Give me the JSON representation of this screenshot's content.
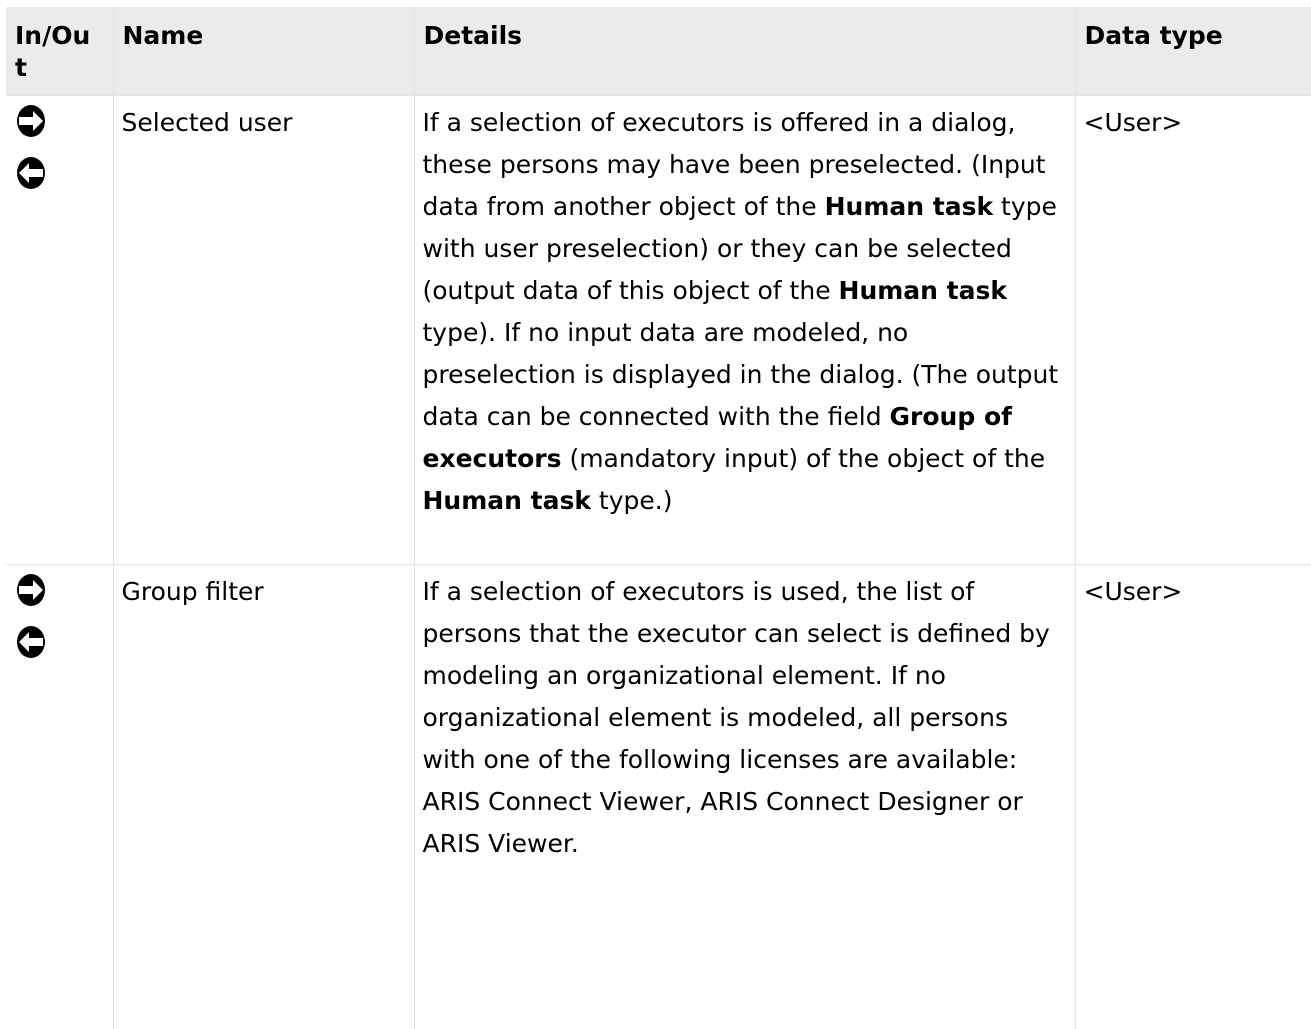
{
  "table": {
    "headers": {
      "inout": "In/Out",
      "name": "Name",
      "details": "Details",
      "datatype": "Data type"
    },
    "rows": [
      {
        "icons": [
          "output-arrow-icon",
          "input-arrow-icon"
        ],
        "name": "Selected user",
        "details": {
          "p1": "If a selection of executors is offered in a dialog, these persons may have been preselected. (Input data from another object of the ",
          "b1": "Human task",
          "p2": " type with user preselection) or they can be selected (output data of this object of the ",
          "b2": "Human task",
          "p3": " type). If no input data are modeled, no preselection is displayed in the dialog. (The output data can be connected with the field ",
          "b3": "Group of executors",
          "p4": " (mandatory input) of the object of the ",
          "b4": "Human task",
          "p5": " type.)"
        },
        "datatype": "<User>"
      },
      {
        "icons": [
          "output-arrow-icon",
          "input-arrow-icon"
        ],
        "name": "Group filter",
        "details": {
          "p1": "If a selection of executors is used, the list of persons that the executor can select is defined by modeling an organizational element. If no organizational element is modeled, all persons with one of the following licenses are available: ARIS Connect Viewer, ARIS Connect Designer or ARIS Viewer."
        },
        "datatype": "<User>"
      }
    ]
  },
  "colors": {
    "header_bg": "#ebebeb",
    "border": "#e4e4e4",
    "text": "#000000"
  }
}
